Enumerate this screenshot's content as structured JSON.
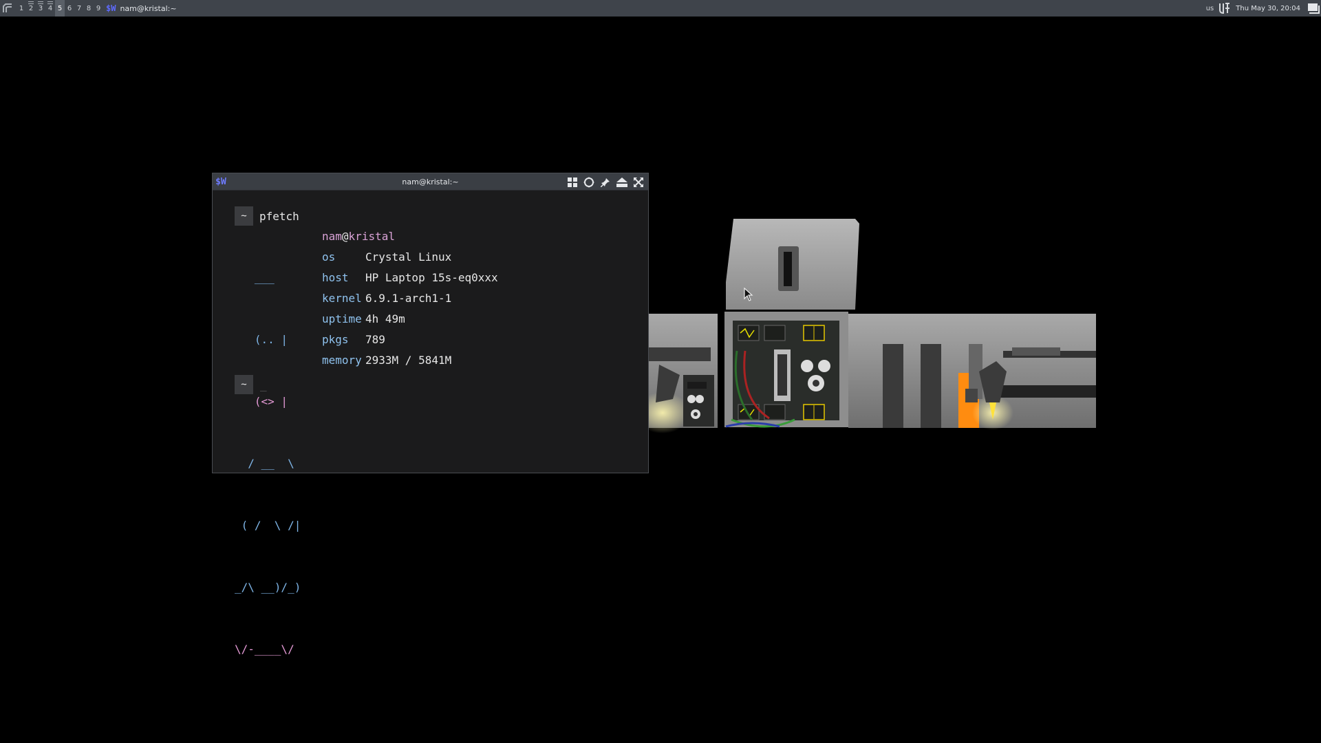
{
  "topbar": {
    "workspaces": [
      {
        "label": "1",
        "occupied": false,
        "active": false
      },
      {
        "label": "2",
        "occupied": true,
        "active": false
      },
      {
        "label": "3",
        "occupied": true,
        "active": false
      },
      {
        "label": "4",
        "occupied": true,
        "active": false
      },
      {
        "label": "5",
        "occupied": false,
        "active": true
      },
      {
        "label": "6",
        "occupied": false,
        "active": false
      },
      {
        "label": "7",
        "occupied": false,
        "active": false
      },
      {
        "label": "8",
        "occupied": false,
        "active": false
      },
      {
        "label": "9",
        "occupied": false,
        "active": false
      }
    ],
    "task_icon": "$W",
    "task_title": "nam@kristal:~",
    "keyboard_layout": "us",
    "clock": "Thu May 30, 20:04"
  },
  "terminal": {
    "app_icon": "$W",
    "title": "nam@kristal:~",
    "prompt_symbol": "~",
    "command": "pfetch",
    "cursor": "_",
    "art": [
      {
        "text": "   ___",
        "color": "blue"
      },
      {
        "text": "   (.. |",
        "color": "blue"
      },
      {
        "text": "   (<> |",
        "color": "pink"
      },
      {
        "text": "  / __  \\",
        "color": "blue"
      },
      {
        "text": " ( /  \\ /|",
        "color": "blue"
      },
      {
        "text": "_/\\ __)/_)",
        "color": "blue"
      },
      {
        "text": "\\/-____\\/",
        "color": "pink"
      }
    ],
    "user": "nam",
    "at": "@",
    "hostname": "kristal",
    "info": [
      {
        "key": "os",
        "value": "Crystal Linux"
      },
      {
        "key": "host",
        "value": "HP Laptop 15s-eq0xxx"
      },
      {
        "key": "kernel",
        "value": "6.9.1-arch1-1"
      },
      {
        "key": "uptime",
        "value": "4h 49m"
      },
      {
        "key": "pkgs",
        "value": "789"
      },
      {
        "key": "memory",
        "value": "2933M / 5841M"
      }
    ]
  },
  "colors": {
    "accent_blue": "#7fb6e8",
    "accent_pink": "#e59ad6",
    "terminal_bg": "#1b1b1c",
    "bar_bg": "#3f444b"
  },
  "icons": {
    "menu": "menu-icon",
    "tray_logo": "system-logo-icon",
    "desktop": "show-desktop-icon",
    "tile": "tile-icon",
    "move": "move-icon",
    "pin": "pin-icon",
    "minimize": "minimize-icon",
    "maximize": "maximize-icon"
  }
}
